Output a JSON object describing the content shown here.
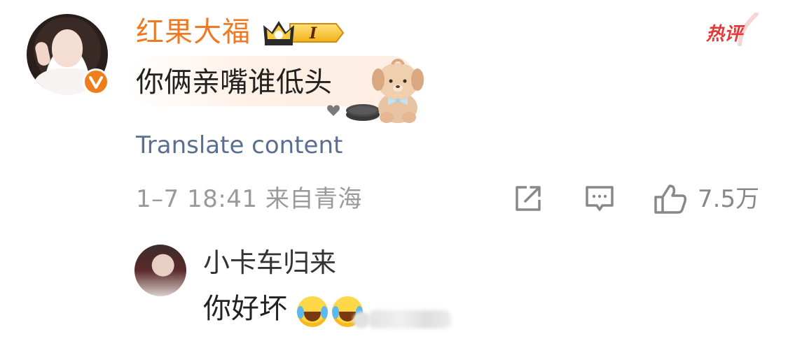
{
  "comment": {
    "username": "红果大福",
    "badge_level": "I",
    "text": "你俩亲嘴谁低头",
    "translate_link": "Translate content",
    "timestamp_location": "1–7 18:41 来自青海",
    "hot_label": "热评",
    "like_count": "7.5万"
  },
  "reply": {
    "username": "小卡车归来",
    "text": "你好坏"
  },
  "colors": {
    "username": "#ee7a23",
    "link": "#5a6f8f",
    "meta": "#9a9a9a",
    "hot": "#e23a3a",
    "verified": "#f07c1c"
  },
  "icons": [
    "verified-icon",
    "crown-badge-icon",
    "bear-sticker-icon",
    "share-icon",
    "comment-icon",
    "like-icon",
    "laugh-cry-emoji-icon"
  ]
}
